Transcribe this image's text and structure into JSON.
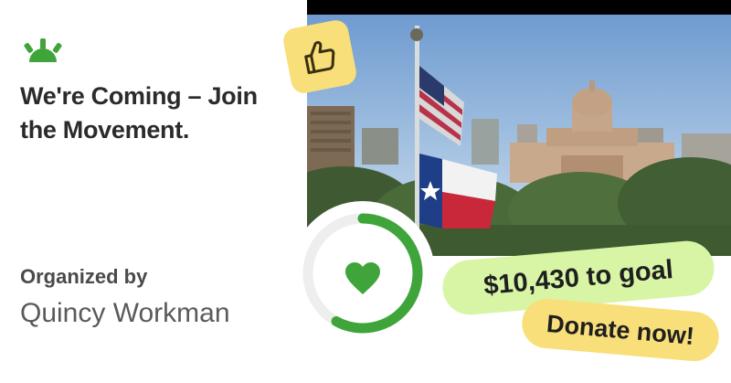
{
  "campaign": {
    "headline": "We're Coming – Join the Movement.",
    "organizer_label": "Organized by",
    "organizer_name": "Quincy Workman",
    "goal_text": "$10,430 to goal",
    "donate_label": "Donate now!",
    "progress_fraction": 0.58
  },
  "icons": {
    "logo": "sunrise-logo-icon",
    "thumbs": "thumbs-up-icon",
    "heart": "heart-icon"
  },
  "colors": {
    "brand_green": "#3fa53a",
    "thumbs_bg": "#f9df79",
    "goal_pill": "#d8f5a6",
    "donate_pill": "#f9df79",
    "text_dark": "#2b2b2b"
  }
}
